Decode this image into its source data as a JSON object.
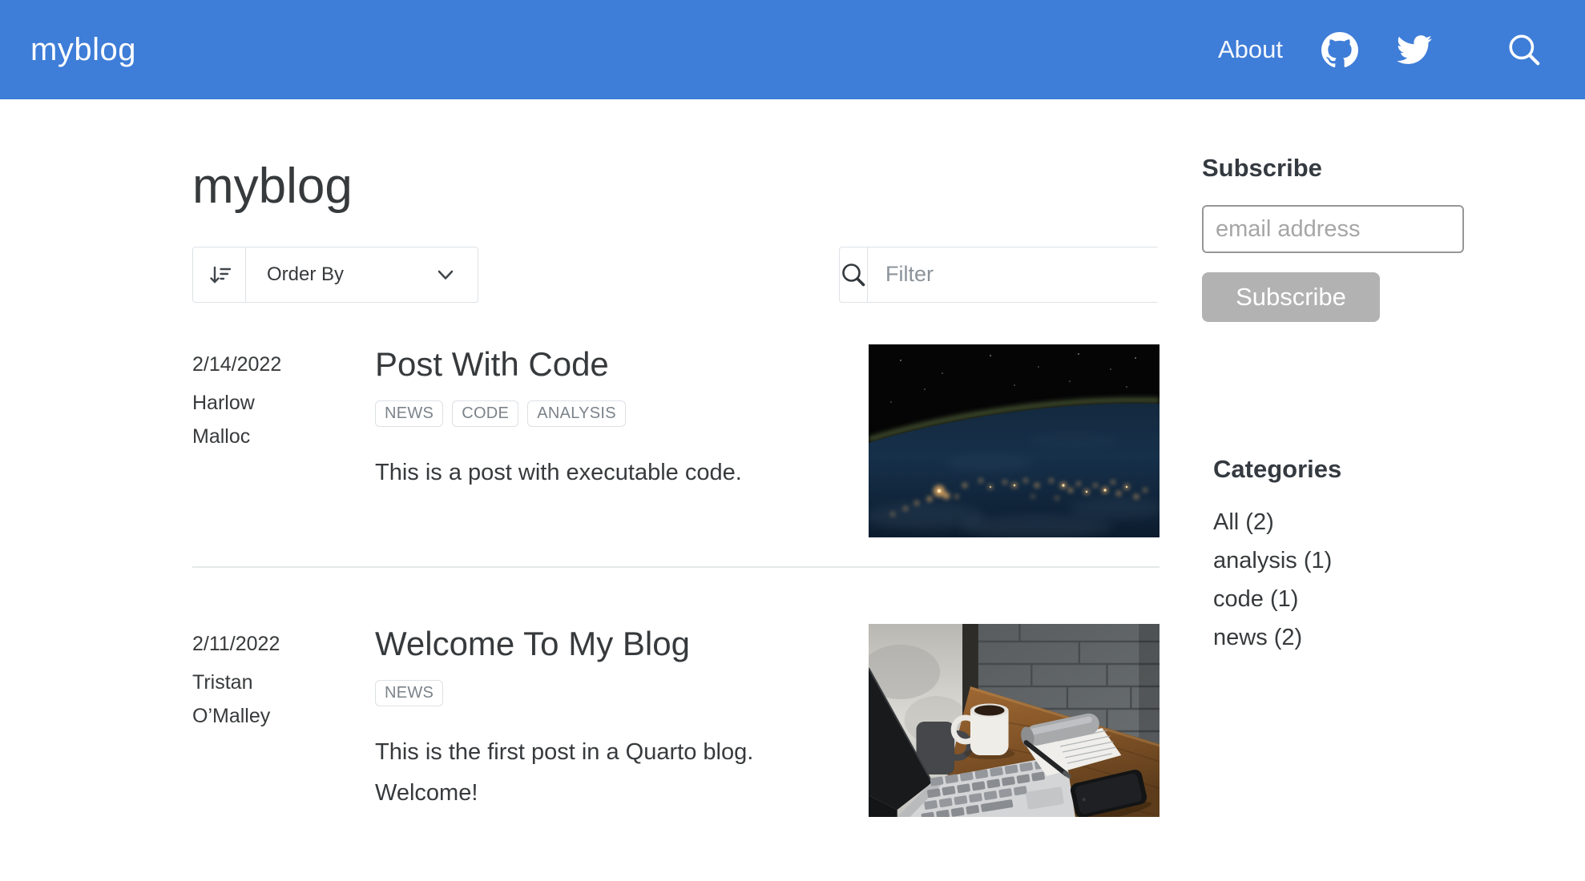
{
  "navbar": {
    "brand": "myblog",
    "about_label": "About",
    "icons": [
      "github-icon",
      "twitter-icon",
      "search-icon"
    ]
  },
  "page": {
    "title": "myblog"
  },
  "listing": {
    "order_by_label": "Order By",
    "filter_placeholder": "Filter"
  },
  "posts": [
    {
      "date": "2/14/2022",
      "author": "Harlow Malloc",
      "title": "Post With Code",
      "tags": [
        "NEWS",
        "CODE",
        "ANALYSIS"
      ],
      "description": "This is a post with executable code.",
      "image": "earth-from-space-at-night"
    },
    {
      "date": "2/11/2022",
      "author": "Tristan O’Malley",
      "title": "Welcome To My Blog",
      "tags": [
        "NEWS"
      ],
      "description": "This is the first post in a Quarto blog. Welcome!",
      "image": "desk-with-laptop-coffee-notepad-phone"
    }
  ],
  "sidebar": {
    "subscribe_heading": "Subscribe",
    "email_placeholder": "email address",
    "subscribe_button": "Subscribe",
    "categories_heading": "Categories",
    "categories": [
      {
        "label": "All (2)"
      },
      {
        "label": "analysis (1)"
      },
      {
        "label": "code (1)"
      },
      {
        "label": "news (2)"
      }
    ]
  },
  "colors": {
    "navbar_bg": "#3e7dd8",
    "subscribe_button_bg": "#b2b2b2",
    "text": "#373a3c",
    "tag_text": "#7b838a",
    "border": "#dee2e6"
  }
}
